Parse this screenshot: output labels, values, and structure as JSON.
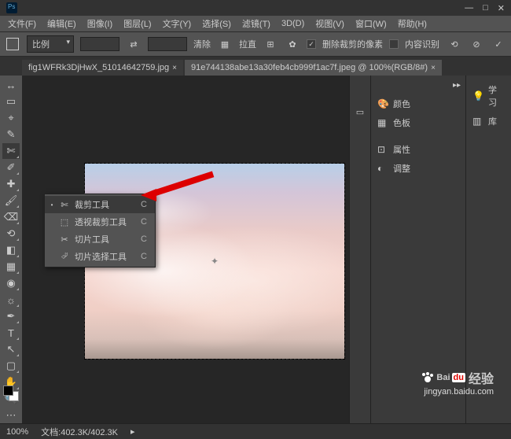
{
  "menu": [
    "文件(F)",
    "编辑(E)",
    "图像(I)",
    "图层(L)",
    "文字(Y)",
    "选择(S)",
    "滤镜(T)",
    "3D(D)",
    "视图(V)",
    "窗口(W)",
    "帮助(H)"
  ],
  "optbar": {
    "ratio_label": "比例",
    "swap": "⇄",
    "clear": "清除",
    "straighten": "拉直",
    "delete_cropped": "删除裁剪的像素",
    "content_aware": "内容识别",
    "gear": "✿"
  },
  "tabs": [
    {
      "label": "fig1WFRk3DjHwX_51014642759.jpg",
      "active": false
    },
    {
      "label": "91e744138abe13a30feb4cb999f1ac7f.jpeg @ 100%(RGB/8#)",
      "active": true
    }
  ],
  "tools": [
    {
      "icon": "↔",
      "name": "move-tool"
    },
    {
      "icon": "▭",
      "name": "marquee-tool"
    },
    {
      "icon": "⌖",
      "name": "lasso-tool"
    },
    {
      "icon": "✎",
      "name": "quick-select-tool"
    },
    {
      "icon": "✄",
      "name": "crop-tool",
      "active": true,
      "hasSub": true
    },
    {
      "icon": "✐",
      "name": "eyedropper-tool",
      "hasSub": true
    },
    {
      "icon": "✚",
      "name": "healing-tool",
      "hasSub": true
    },
    {
      "icon": "🖌",
      "name": "brush-tool",
      "hasSub": true
    },
    {
      "icon": "⌫",
      "name": "stamp-tool",
      "hasSub": true
    },
    {
      "icon": "⟲",
      "name": "history-brush-tool",
      "hasSub": true
    },
    {
      "icon": "◧",
      "name": "eraser-tool",
      "hasSub": true
    },
    {
      "icon": "▦",
      "name": "gradient-tool",
      "hasSub": true
    },
    {
      "icon": "◉",
      "name": "blur-tool",
      "hasSub": true
    },
    {
      "icon": "☼",
      "name": "dodge-tool",
      "hasSub": true
    },
    {
      "icon": "✒",
      "name": "pen-tool",
      "hasSub": true
    },
    {
      "icon": "T",
      "name": "type-tool",
      "hasSub": true
    },
    {
      "icon": "↖",
      "name": "path-select-tool",
      "hasSub": true
    },
    {
      "icon": "▢",
      "name": "shape-tool",
      "hasSub": true
    },
    {
      "icon": "✋",
      "name": "hand-tool",
      "hasSub": true
    },
    {
      "icon": "🔍",
      "name": "zoom-tool"
    },
    {
      "icon": "⋯",
      "name": "edit-toolbar"
    }
  ],
  "flyout": [
    {
      "icon": "✄",
      "label": "裁剪工具",
      "shortcut": "C",
      "active": true
    },
    {
      "icon": "⬚",
      "label": "透视裁剪工具",
      "shortcut": "C"
    },
    {
      "icon": "✂",
      "label": "切片工具",
      "shortcut": "C"
    },
    {
      "icon": "⮰",
      "label": "切片选择工具",
      "shortcut": "C"
    }
  ],
  "panels": {
    "color": "颜色",
    "swatches": "色板",
    "properties": "属性",
    "adjustments": "调整",
    "learn": "学习",
    "libraries": "库"
  },
  "status": {
    "zoom": "100%",
    "doc": "文档:402.3K/402.3K"
  },
  "watermark": {
    "brand": "Baidu百度经验",
    "url": "jingyan.baidu.com"
  }
}
